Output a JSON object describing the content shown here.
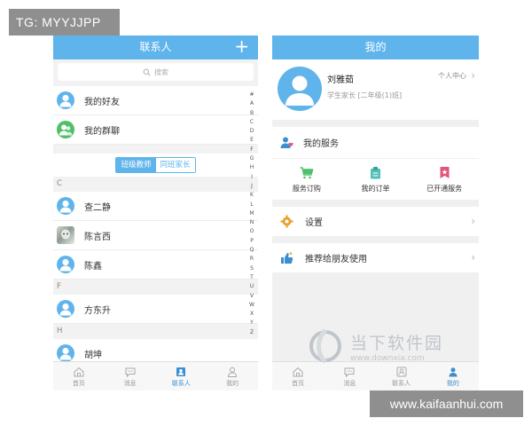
{
  "watermarks": {
    "top_left": "TG: MYYJJPP",
    "bottom_right": "www.kaifaanhui.com",
    "logo_main": "当下软件园",
    "logo_sub": "www.downxia.com"
  },
  "contacts": {
    "title": "联系人",
    "add_glyph": "+",
    "search_placeholder": "搜索",
    "fixed_rows": [
      {
        "label": "我的好友",
        "icon": "person-icon"
      },
      {
        "label": "我的群聊",
        "icon": "group-icon"
      }
    ],
    "segments": [
      "班级教师",
      "同班家长"
    ],
    "sections": [
      {
        "letter": "C",
        "items": [
          {
            "name": "查二静",
            "avatar": "person-icon"
          },
          {
            "name": "陈言西",
            "avatar": "photo-avatar"
          },
          {
            "name": "陈鑫",
            "avatar": "person-icon"
          }
        ]
      },
      {
        "letter": "F",
        "items": [
          {
            "name": "方东升",
            "avatar": "person-icon"
          }
        ]
      },
      {
        "letter": "H",
        "items": [
          {
            "name": "胡坤",
            "avatar": "person-icon"
          }
        ]
      }
    ],
    "index_letters": [
      "#",
      "A",
      "B",
      "C",
      "D",
      "E",
      "F",
      "G",
      "H",
      "I",
      "J",
      "K",
      "L",
      "M",
      "N",
      "O",
      "P",
      "Q",
      "R",
      "S",
      "T",
      "U",
      "V",
      "W",
      "X",
      "Y",
      "Z"
    ]
  },
  "tabbar": {
    "tabs": [
      {
        "label": "首页",
        "icon": "home-icon"
      },
      {
        "label": "消息",
        "icon": "message-icon"
      },
      {
        "label": "联系人",
        "icon": "contacts-icon"
      },
      {
        "label": "我的",
        "icon": "profile-icon"
      }
    ],
    "left_active": 2,
    "right_active": 3
  },
  "me": {
    "title": "我的",
    "name": "刘雅茹",
    "role": "学生家长 [二年级(1)班]",
    "personal_center": "个人中心",
    "my_services_label": "我的服务",
    "services": [
      {
        "label": "服务订购",
        "icon": "cart-icon"
      },
      {
        "label": "我的订单",
        "icon": "order-icon"
      },
      {
        "label": "已开通服务",
        "icon": "ribbon-icon"
      }
    ],
    "settings_label": "设置",
    "recommend_label": "推荐给朋友使用"
  },
  "colors": {
    "accent": "#5fb4ec",
    "tab_active": "#3b8fd0",
    "green": "#4fbf6a",
    "pink": "#e2557a",
    "orange": "#e9a12f"
  }
}
